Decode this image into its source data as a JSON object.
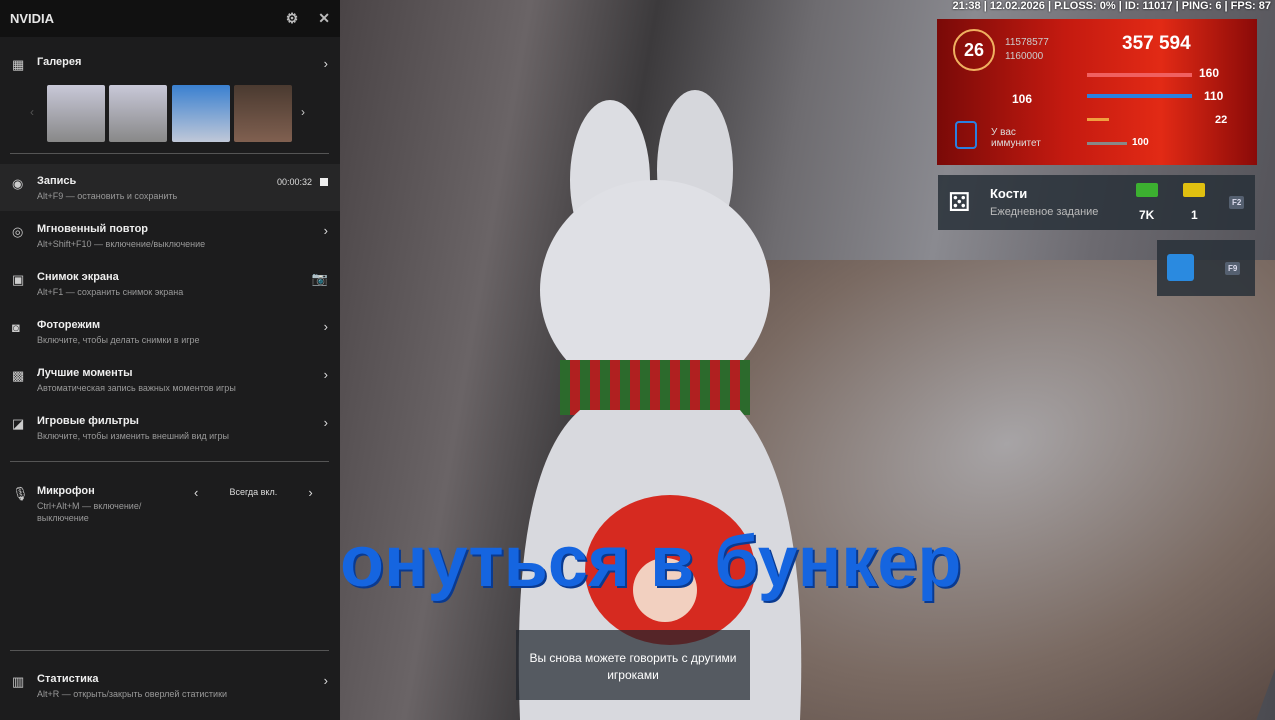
{
  "sidebar": {
    "title": "NVIDIA",
    "gallery": "Галерея",
    "items": [
      {
        "title": "Запись",
        "sub": "Alt+F9 — остановить и сохранить",
        "right": "00:00:32"
      },
      {
        "title": "Мгновенный повтор",
        "sub": "Alt+Shift+F10 — включение/выключение"
      },
      {
        "title": "Снимок экрана",
        "sub": "Alt+F1 — сохранить снимок экрана"
      },
      {
        "title": "Фоторежим",
        "sub": "Включите, чтобы делать снимки в игре"
      },
      {
        "title": "Лучшие моменты",
        "sub": "Автоматическая запись важных моментов игры"
      },
      {
        "title": "Игровые фильтры",
        "sub": "Включите, чтобы изменить внешний вид игры"
      }
    ],
    "mic": {
      "title": "Микрофон",
      "sub": "Ctrl+Alt+M — включение/выключение",
      "value": "Всегда вкл."
    },
    "stats": {
      "title": "Статистика",
      "sub": "Alt+R — открыть/закрыть оверлей статистики"
    }
  },
  "hud": {
    "status": "21:38 | 12.02.2026 | P.LOSS: 0% | ID: 11017 | PING: 6 | FPS: 87",
    "level": "26",
    "xp": "11578577",
    "xp_max": "1160000",
    "money": "357 594",
    "health": "160",
    "armor": "110",
    "hunger": "106",
    "ammo": "22",
    "stamina": "100",
    "immunity": "У вас иммунитет",
    "task_title": "Кости",
    "task_sub": "Ежедневное задание",
    "reward1": "7K",
    "reward2": "1",
    "key1": "F2",
    "key2": "F9"
  },
  "subtitle": "онуться в бункер",
  "caption": "Вы снова можете говорить с другими игроками"
}
